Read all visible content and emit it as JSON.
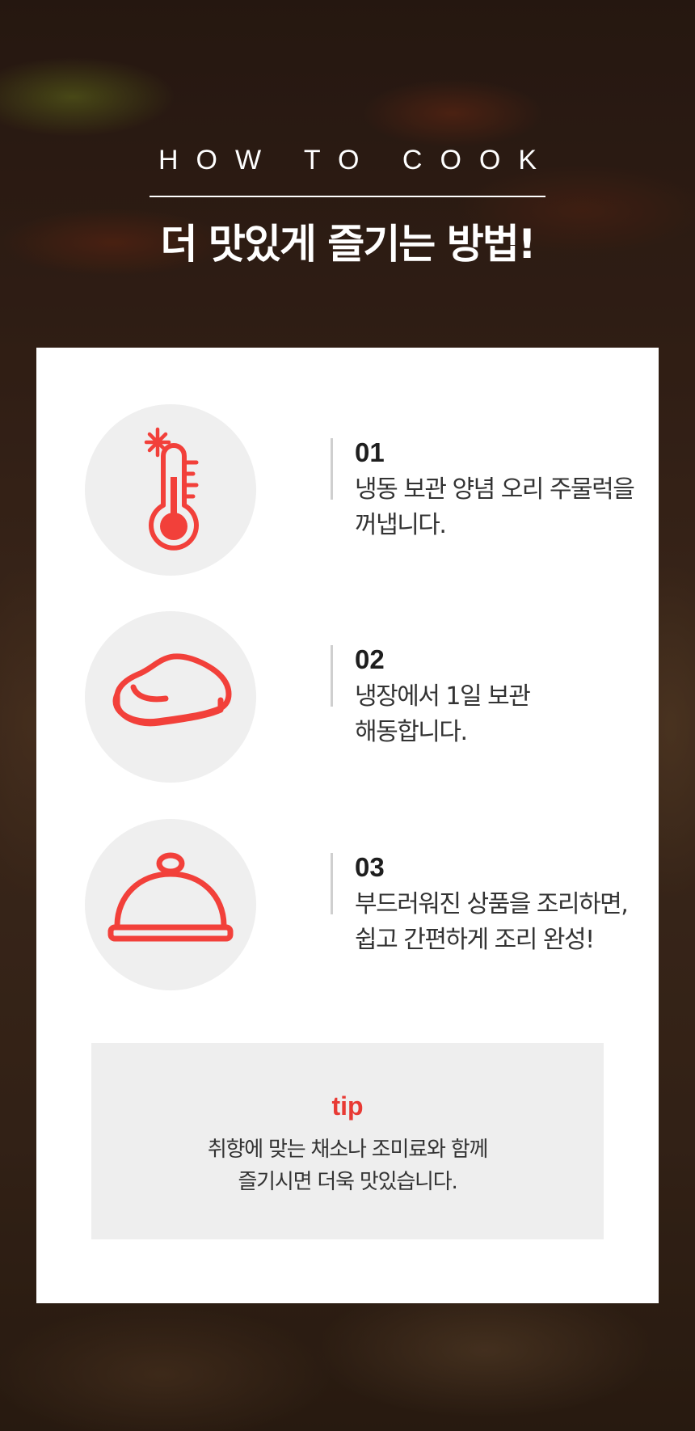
{
  "header": {
    "eyebrow": "HOW TO COOK",
    "title": "더 맛있게 즐기는 방법!"
  },
  "steps": [
    {
      "number": "01",
      "line1": "냉동 보관 양념 오리 주물럭을",
      "line2": "꺼냅니다.",
      "icon": "thermometer-snowflake-icon"
    },
    {
      "number": "02",
      "line1": "냉장에서 1일 보관",
      "line2": "해동합니다.",
      "icon": "steak-icon"
    },
    {
      "number": "03",
      "line1": "부드러워진 상품을 조리하면,",
      "line2": "쉽고 간편하게 조리 완성!",
      "icon": "cloche-icon"
    }
  ],
  "tip": {
    "label": "tip",
    "line1": "취향에 맞는 채소나 조미료와 함께",
    "line2": "즐기시면 더욱 맛있습니다."
  },
  "colors": {
    "accent": "#f2403a",
    "circle_bg": "#efefef",
    "tip_bg": "#eeeeee"
  }
}
